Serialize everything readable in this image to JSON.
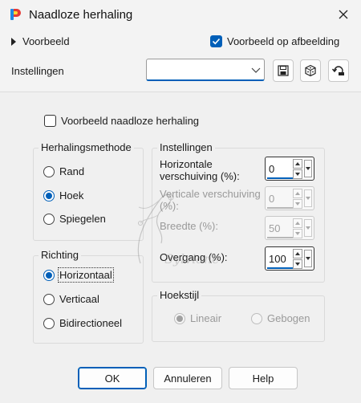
{
  "window": {
    "title": "Naadloze herhaling",
    "close_icon": "close-icon"
  },
  "preview": {
    "toggle_label": "Voorbeeld",
    "on_image_label": "Voorbeeld op afbeelding",
    "on_image_checked": true
  },
  "settings_row": {
    "label": "Instellingen",
    "preset_value": "",
    "tools": [
      "save-preset-icon",
      "randomize-icon",
      "reset-icon"
    ]
  },
  "main": {
    "seamless_preview_label": "Voorbeeld naadloze herhaling",
    "seamless_preview_checked": false,
    "method_group": {
      "title": "Herhalingsmethode",
      "options": [
        "Rand",
        "Hoek",
        "Spiegelen"
      ],
      "selected": "Hoek"
    },
    "direction_group": {
      "title": "Richting",
      "options": [
        "Horizontaal",
        "Verticaal",
        "Bidirectioneel"
      ],
      "selected": "Horizontaal"
    },
    "settings_group": {
      "title": "Instellingen",
      "fields": [
        {
          "label": "Horizontale verschuiving (%):",
          "value": "0",
          "enabled": true
        },
        {
          "label": "Verticale verschuiving (%):",
          "value": "0",
          "enabled": false
        },
        {
          "label": "Breedte (%):",
          "value": "50",
          "enabled": false
        },
        {
          "label": "Overgang (%):",
          "value": "100",
          "enabled": true
        }
      ]
    },
    "corner_group": {
      "title": "Hoekstijl",
      "options": [
        "Lineair",
        "Gebogen"
      ],
      "selected": "Lineair",
      "enabled": false
    }
  },
  "buttons": {
    "ok": "OK",
    "cancel": "Annuleren",
    "help": "Help"
  },
  "colors": {
    "accent": "#005fb8",
    "panel": "#f0f0f0",
    "titlebar": "#f3f3f3"
  },
  "watermark": "Sylviane"
}
